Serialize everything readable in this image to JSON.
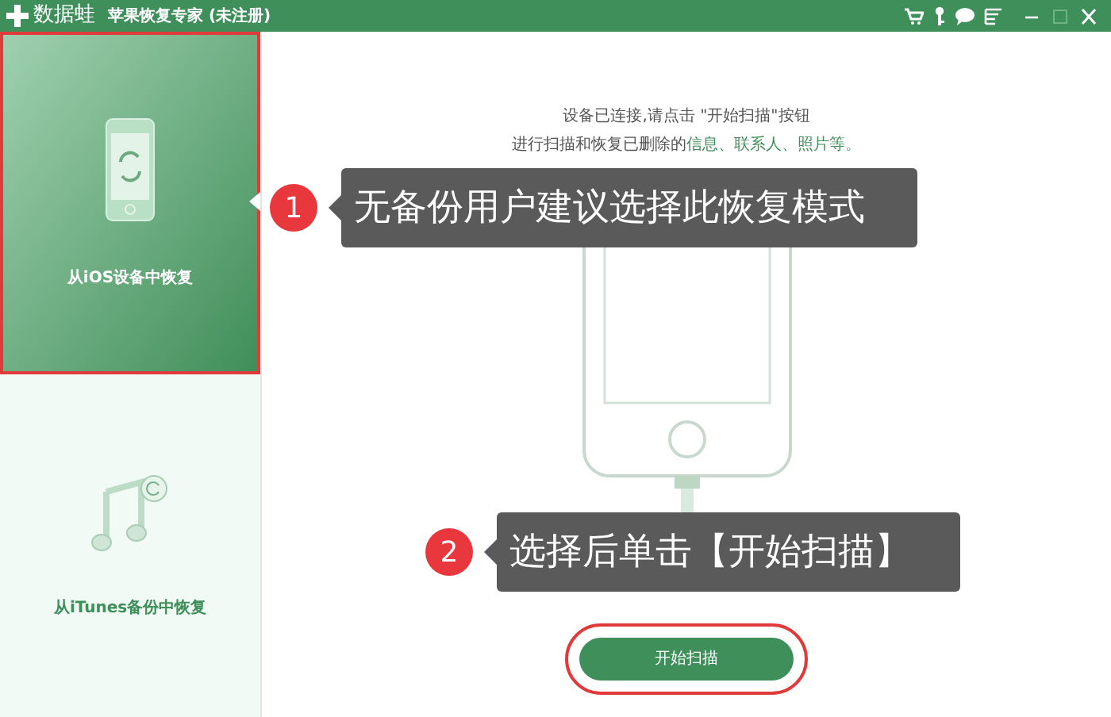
{
  "window": {
    "logo": "数据蛙",
    "title": "苹果恢复专家 (未注册)"
  },
  "sidebar": {
    "items": [
      {
        "kind": "device",
        "label": "从iOS设备中恢复",
        "selected": true
      },
      {
        "kind": "itunes",
        "label": "从iTunes备份中恢复",
        "selected": false
      }
    ]
  },
  "main": {
    "instruction": "设备已连接,请点击 \"开始扫描\"按钮",
    "detail": "进行扫描和恢复已删除的",
    "detail_link": "信息、联系人、照片等。",
    "scan_button": "开始扫描"
  },
  "callouts": [
    {
      "number": "1",
      "text": "无备份用户建议选择此恢复模式"
    },
    {
      "number": "2",
      "text": "选择后单击【开始扫描】"
    }
  ]
}
